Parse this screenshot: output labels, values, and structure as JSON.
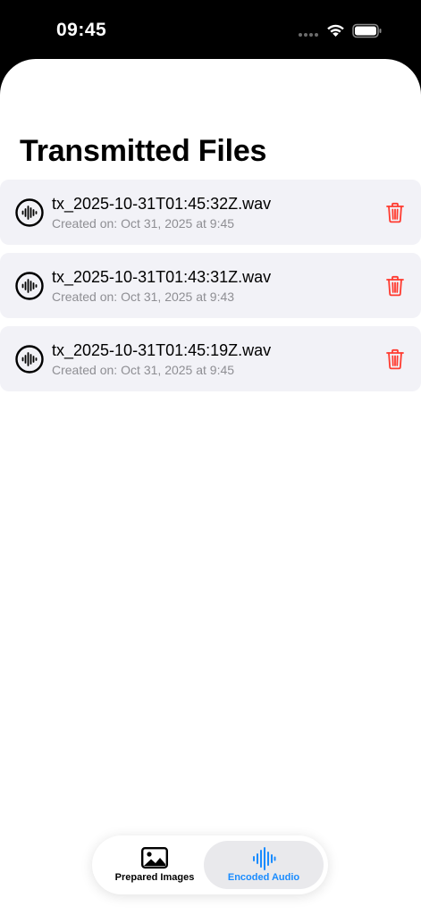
{
  "status_bar": {
    "time": "09:45"
  },
  "page": {
    "title": "Transmitted Files"
  },
  "files": [
    {
      "name": "tx_2025-10-31T01:45:32Z.wav",
      "created_prefix": "Created on:",
      "created_date": "Oct 31, 2025 at 9:45"
    },
    {
      "name": "tx_2025-10-31T01:43:31Z.wav",
      "created_prefix": "Created on:",
      "created_date": "Oct 31, 2025 at 9:43"
    },
    {
      "name": "tx_2025-10-31T01:45:19Z.wav",
      "created_prefix": "Created on:",
      "created_date": "Oct 31, 2025 at 9:45"
    }
  ],
  "tab_bar": {
    "tabs": [
      {
        "label": "Prepared Images",
        "icon": "photo-icon",
        "selected": false
      },
      {
        "label": "Encoded Audio",
        "icon": "waveform-icon",
        "selected": true
      }
    ]
  },
  "colors": {
    "accent": "#1a8cff",
    "destructive": "#ff3b30",
    "row_background": "#f2f2f7",
    "secondary_text": "#8e8e93"
  }
}
